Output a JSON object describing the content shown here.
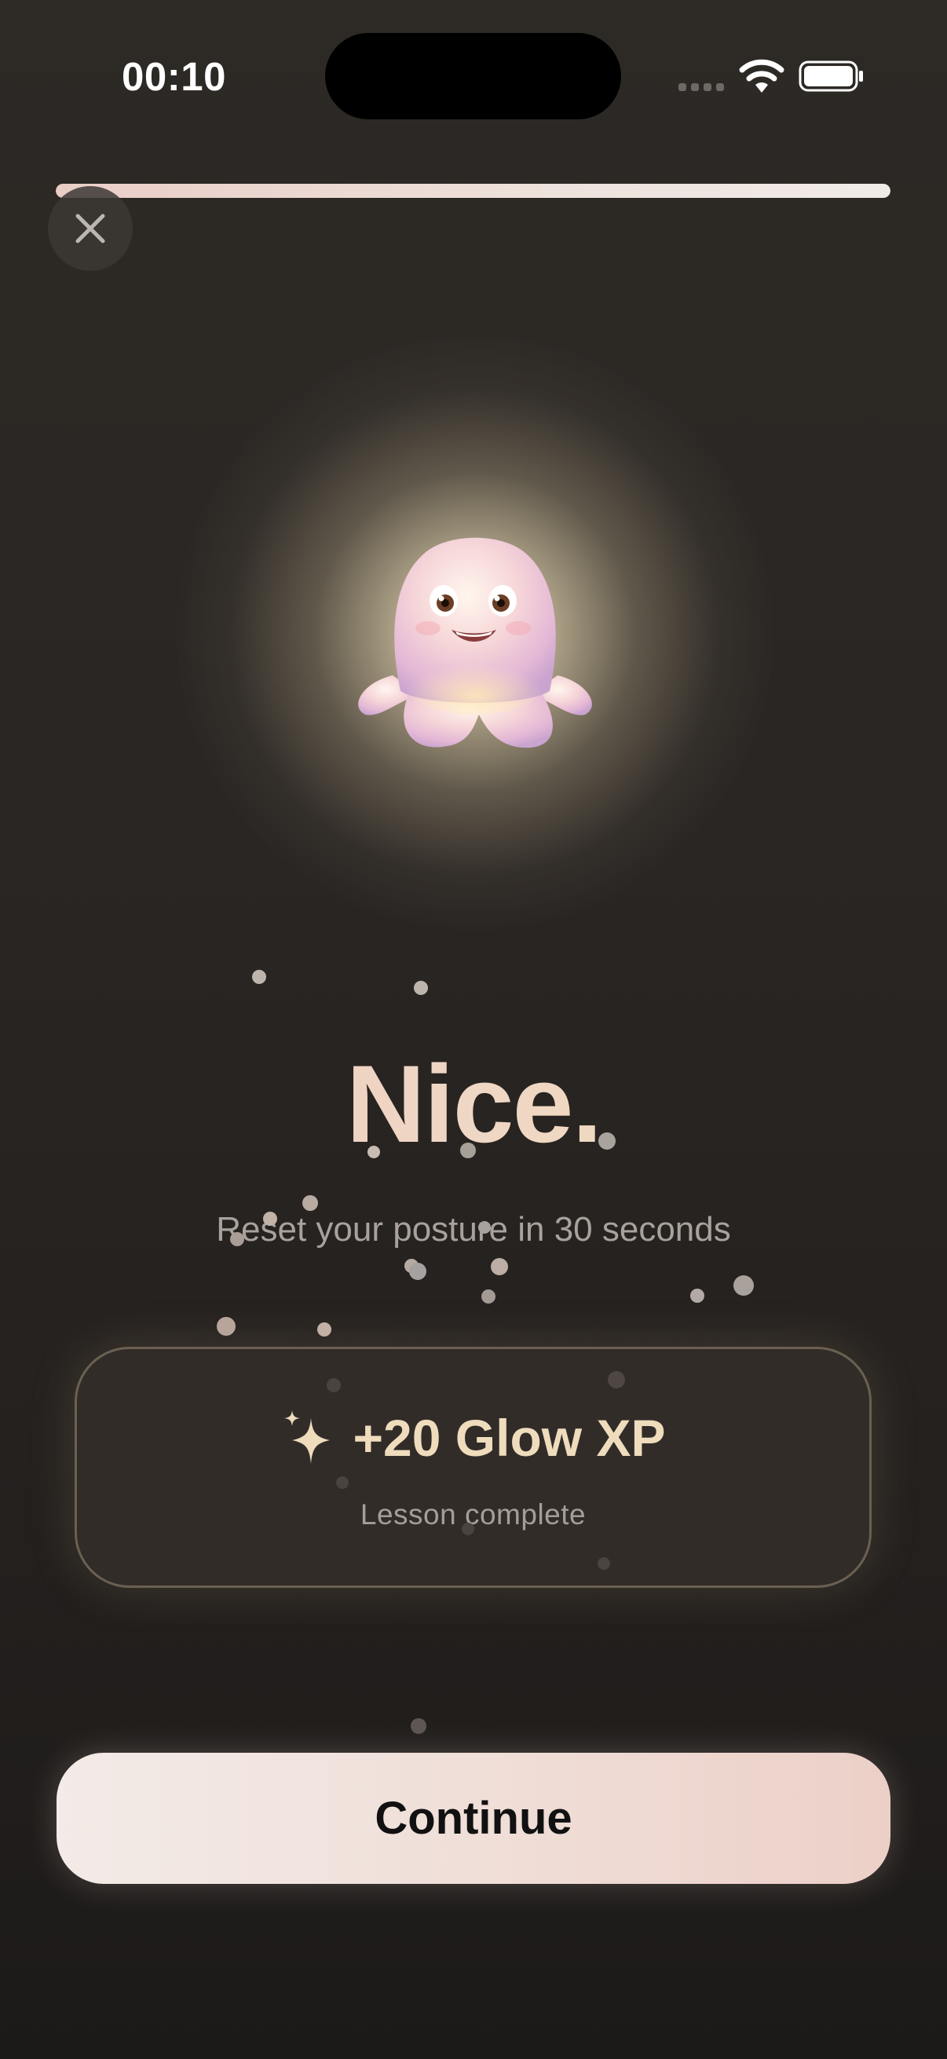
{
  "status_bar": {
    "time": "00:10",
    "signal_icon": "cellular-signal-icon",
    "wifi_icon": "wifi-icon",
    "battery_icon": "battery-icon"
  },
  "progress": {
    "fraction": 1.0
  },
  "close_button": {
    "icon": "close-icon"
  },
  "mascot": {
    "icon": "octopus-mascot-icon"
  },
  "title": "Nice.",
  "subtitle": "Reset your posture in 30 seconds",
  "reward": {
    "icon": "sparkles-icon",
    "xp_text": "+20 Glow XP",
    "caption": "Lesson complete"
  },
  "continue_button": {
    "label": "Continue"
  },
  "colors": {
    "background": "#2a2623",
    "accent_gold": "#eedcbc",
    "accent_pink": "#ecd0c8",
    "text_muted": "#a9a29c"
  }
}
